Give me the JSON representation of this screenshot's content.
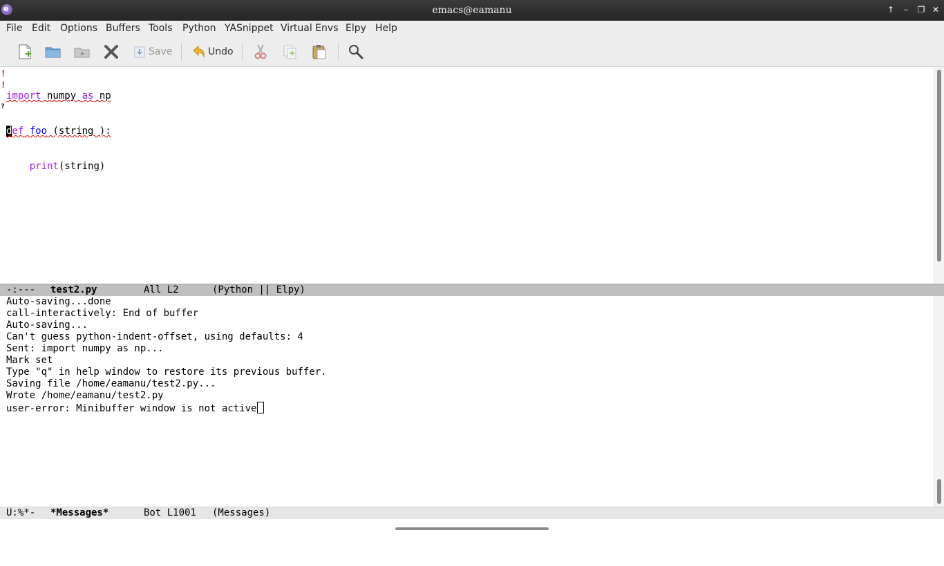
{
  "window": {
    "title": "emacs@eamanu"
  },
  "menubar": {
    "items": [
      "File",
      "Edit",
      "Options",
      "Buffers",
      "Tools",
      "Python",
      "YASnippet",
      "Virtual Envs",
      "Elpy",
      "Help"
    ]
  },
  "toolbar": {
    "save_label": "Save",
    "undo_label": "Undo"
  },
  "editor": {
    "fringe_warning_1": "!",
    "fringe_warning_2": "!",
    "fringe_unknown": "?",
    "line1": {
      "kw1": "import",
      "mod": " numpy ",
      "kw2": "as",
      "alias": " np"
    },
    "line2": {
      "cursor_char": "d",
      "kw_rest": "ef",
      "space": " ",
      "fn": "foo",
      "rest": " (string ):"
    },
    "line3": {
      "indent": "    ",
      "builtin": "print",
      "rest": "(string)"
    }
  },
  "modeline_top": {
    "status": "-:---",
    "buffer": "test2.py",
    "position": "All L2",
    "modes": "(Python || Elpy)"
  },
  "messages": {
    "lines": [
      "Auto-saving...done",
      "call-interactively: End of buffer",
      "Auto-saving...",
      "Can't guess python-indent-offset, using defaults: 4",
      "Sent: import numpy as np...",
      "Mark set",
      "Type \"q\" in help window to restore its previous buffer.",
      "Saving file /home/eamanu/test2.py...",
      "Wrote /home/eamanu/test2.py",
      "user-error: Minibuffer window is not active"
    ]
  },
  "modeline_bottom": {
    "status": "U:%*-",
    "buffer": "*Messages*",
    "position": "Bot L1001",
    "modes": "(Messages)"
  }
}
